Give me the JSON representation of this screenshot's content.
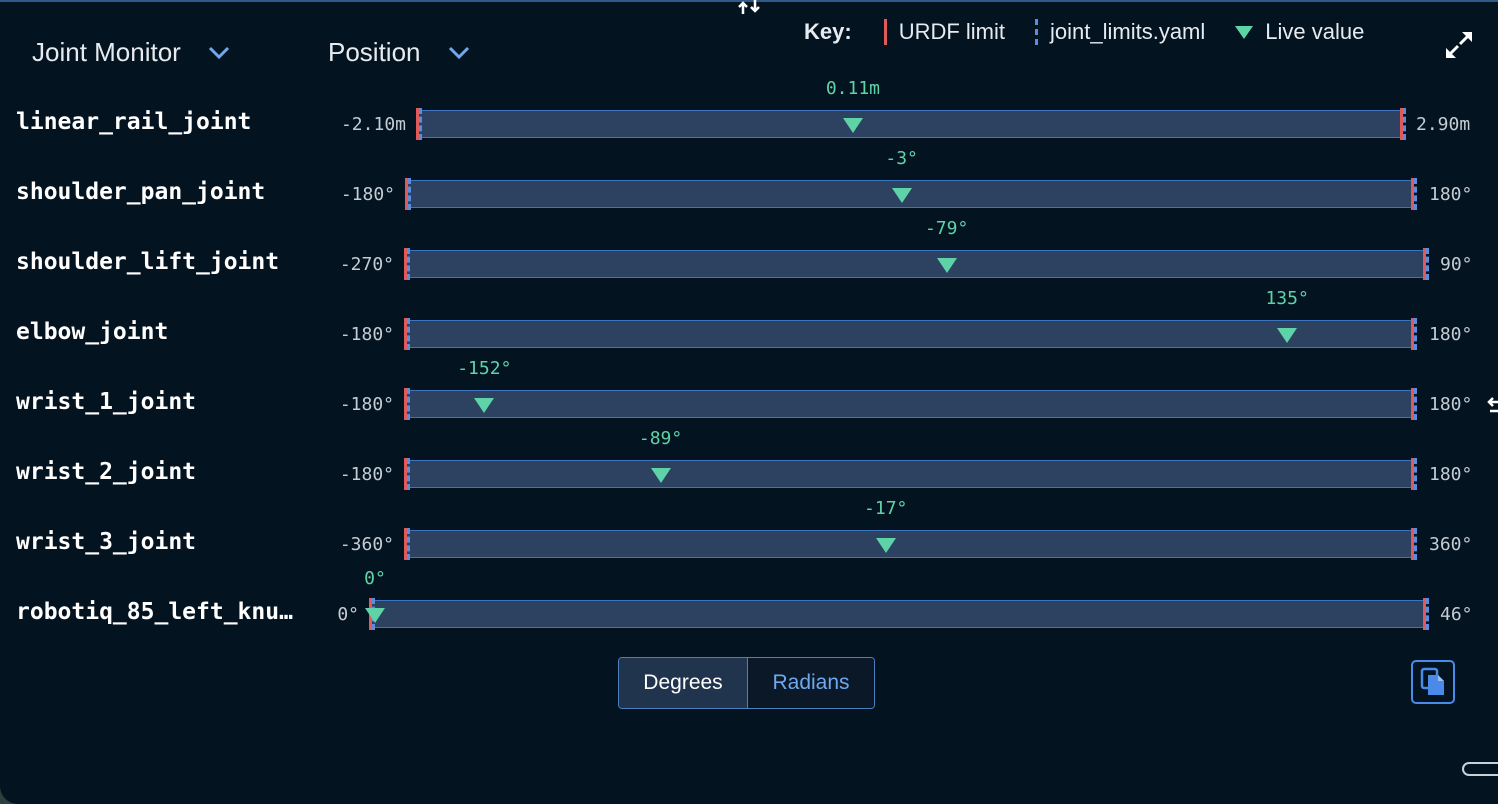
{
  "header": {
    "view_selector": "Joint Monitor",
    "mode_selector": "Position"
  },
  "key": {
    "title": "Key:",
    "items": [
      {
        "label": "URDF limit",
        "color": "#e05a5a"
      },
      {
        "label": "joint_limits.yaml",
        "color": "#5a8de0"
      },
      {
        "label": "Live value",
        "color": "#5fd3a8"
      }
    ]
  },
  "joints": [
    {
      "name": "linear_rail_joint",
      "min": -2.1,
      "max": 2.9,
      "value": 0.11,
      "min_label": "-2.10m",
      "max_label": "2.90m",
      "value_label": "0.11m"
    },
    {
      "name": "shoulder_pan_joint",
      "min": -180,
      "max": 180,
      "value": -3,
      "min_label": "-180°",
      "max_label": "180°",
      "value_label": "-3°"
    },
    {
      "name": "shoulder_lift_joint",
      "min": -270,
      "max": 90,
      "value": -79,
      "min_label": "-270°",
      "max_label": "90°",
      "value_label": "-79°"
    },
    {
      "name": "elbow_joint",
      "min": -180,
      "max": 180,
      "value": 135,
      "min_label": "-180°",
      "max_label": "180°",
      "value_label": "135°"
    },
    {
      "name": "wrist_1_joint",
      "min": -180,
      "max": 180,
      "value": -152,
      "min_label": "-180°",
      "max_label": "180°",
      "value_label": "-152°"
    },
    {
      "name": "wrist_2_joint",
      "min": -180,
      "max": 180,
      "value": -89,
      "min_label": "-180°",
      "max_label": "180°",
      "value_label": "-89°"
    },
    {
      "name": "wrist_3_joint",
      "min": -360,
      "max": 360,
      "value": -17,
      "min_label": "-360°",
      "max_label": "360°",
      "value_label": "-17°"
    },
    {
      "name": "robotiq_85_left_knu…",
      "min": 0,
      "max": 46,
      "value": 0,
      "min_label": "0°",
      "max_label": "46°",
      "value_label": "0°"
    }
  ],
  "units": {
    "degrees": "Degrees",
    "radians": "Radians",
    "selected": "degrees"
  },
  "icons": {
    "dropdown": "chevron-down-icon",
    "expand": "expand-icon",
    "copy": "copy-icon",
    "sort": "sort-arrows-icon"
  }
}
